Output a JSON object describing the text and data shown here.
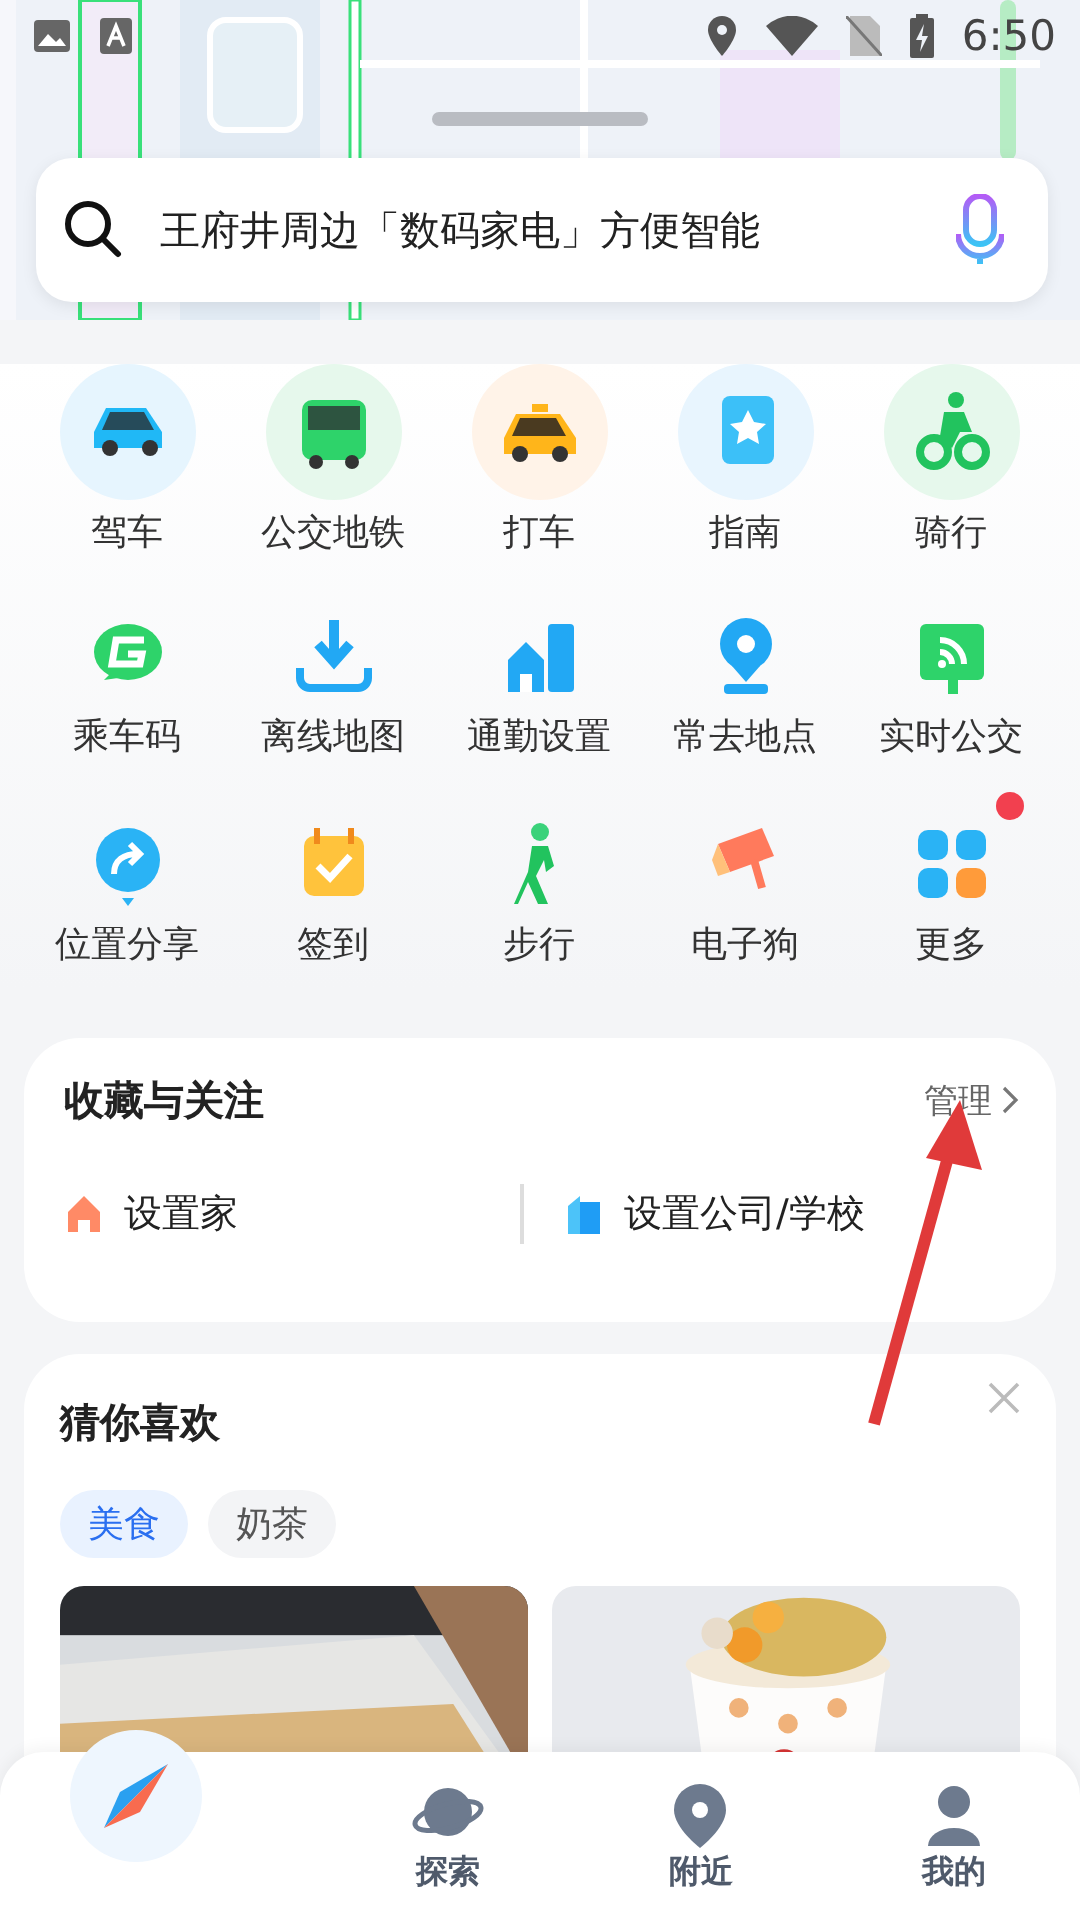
{
  "status_bar": {
    "time": "6:50"
  },
  "search": {
    "placeholder": "王府井周边「数码家电」方便智能"
  },
  "primary_shortcuts": [
    {
      "label": "驾车"
    },
    {
      "label": "公交地铁"
    },
    {
      "label": "打车"
    },
    {
      "label": "指南"
    },
    {
      "label": "骑行"
    }
  ],
  "shortcuts": [
    {
      "label": "乘车码",
      "dot": false
    },
    {
      "label": "离线地图",
      "dot": false
    },
    {
      "label": "通勤设置",
      "dot": false
    },
    {
      "label": "常去地点",
      "dot": false
    },
    {
      "label": "实时公交",
      "dot": false
    },
    {
      "label": "位置分享",
      "dot": false
    },
    {
      "label": "签到",
      "dot": false
    },
    {
      "label": "步行",
      "dot": false
    },
    {
      "label": "电子狗",
      "dot": false
    },
    {
      "label": "更多",
      "dot": true
    }
  ],
  "favorites": {
    "title": "收藏与关注",
    "manage": "管理",
    "places": [
      {
        "label": "设置家"
      },
      {
        "label": "设置公司/学校"
      }
    ]
  },
  "recommend": {
    "title": "猜你喜欢",
    "chips": [
      {
        "label": "美食",
        "selected": true
      },
      {
        "label": "奶茶",
        "selected": false
      }
    ]
  },
  "bottom_nav": [
    {
      "label": "探索"
    },
    {
      "label": "附近"
    },
    {
      "label": "我的"
    }
  ]
}
